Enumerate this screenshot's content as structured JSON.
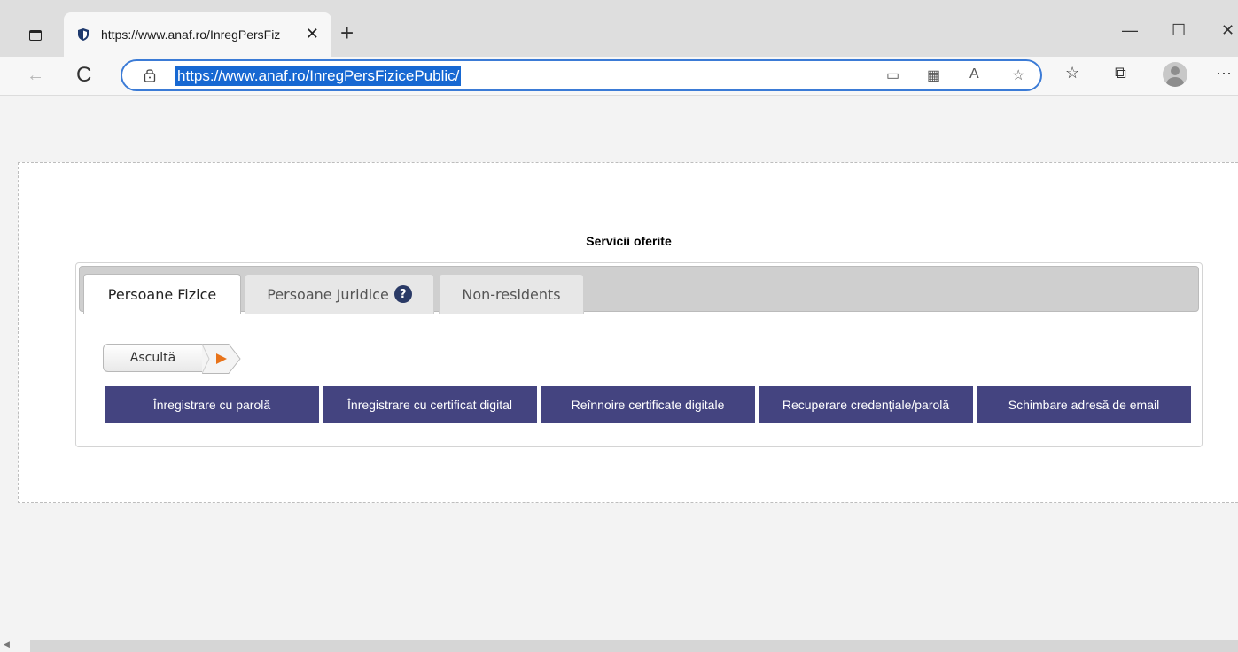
{
  "browser": {
    "tab_title": "https://www.anaf.ro/InregPersFiz",
    "close_tab": "✕",
    "new_tab": "+",
    "minimize": "—",
    "maximize": "☐",
    "close_window": "✕",
    "back": "←",
    "reload": "C",
    "url": "https://www.anaf.ro/InregPersFizicePublic/",
    "favorites": "☆",
    "collections": "⧉",
    "more": "···"
  },
  "page": {
    "section_title": "Servicii oferite",
    "tabs": [
      {
        "label": "Persoane Fizice",
        "active": true
      },
      {
        "label": "Persoane Juridice",
        "active": false,
        "help": "?"
      },
      {
        "label": "Non-residents",
        "active": false
      }
    ],
    "listen_label": "Ascultă",
    "actions": [
      "Înregistrare cu parolă",
      "Înregistrare cu certificat digital",
      "Reînnoire certificate digitale",
      "Recuperare credențiale/parolă",
      "Schimbare adresă de email"
    ]
  },
  "colors": {
    "action_button_bg": "#444480",
    "url_selection": "#1768d2",
    "play_icon": "#e8731a"
  }
}
